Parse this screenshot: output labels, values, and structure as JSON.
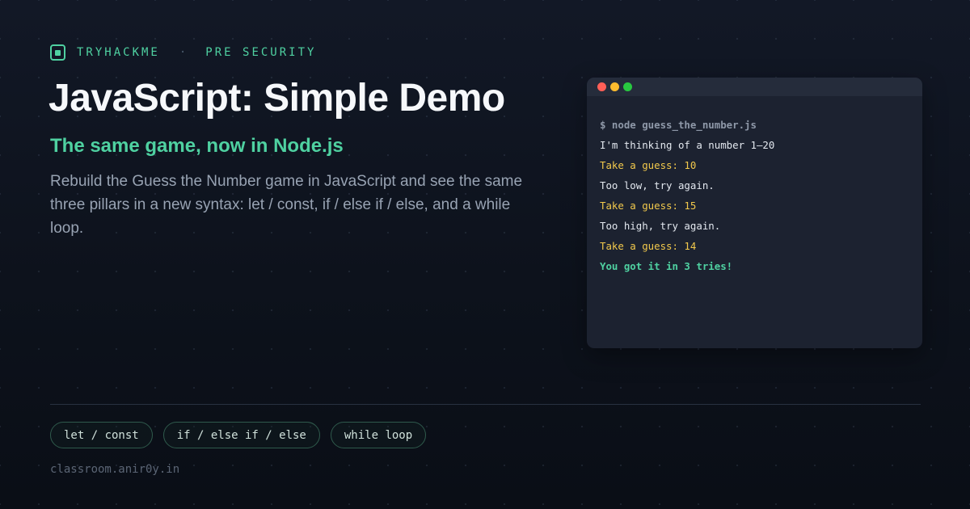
{
  "brand": {
    "icon": "chip-icon",
    "name": "TRYHACKME",
    "separator": "·",
    "section": "PRE SECURITY"
  },
  "hero": {
    "title": "JavaScript: Simple Demo",
    "subtitle": "The same game, now in Node.js",
    "description": "Rebuild the Guess the Number game in JavaScript and see the same three pillars in a new syntax: let / const, if / else if / else, and a while loop."
  },
  "terminal": {
    "lines": [
      "$ node guess_the_number.js",
      "I'm thinking of a number 1–20",
      "Take a guess: 10",
      "Too low, try again.",
      "Take a guess: 15",
      "Too high, try again.",
      "Take a guess: 14",
      "You got it in 3 tries!"
    ]
  },
  "tags": [
    "let / const",
    "if / else if / else",
    "while loop"
  ],
  "footer": {
    "url": "classroom.anir0y.in"
  },
  "colors": {
    "accent": "#4fd1a1",
    "background": "#0b0f17",
    "terminal_bg": "#1c2230",
    "guess": "#f2c94c"
  }
}
